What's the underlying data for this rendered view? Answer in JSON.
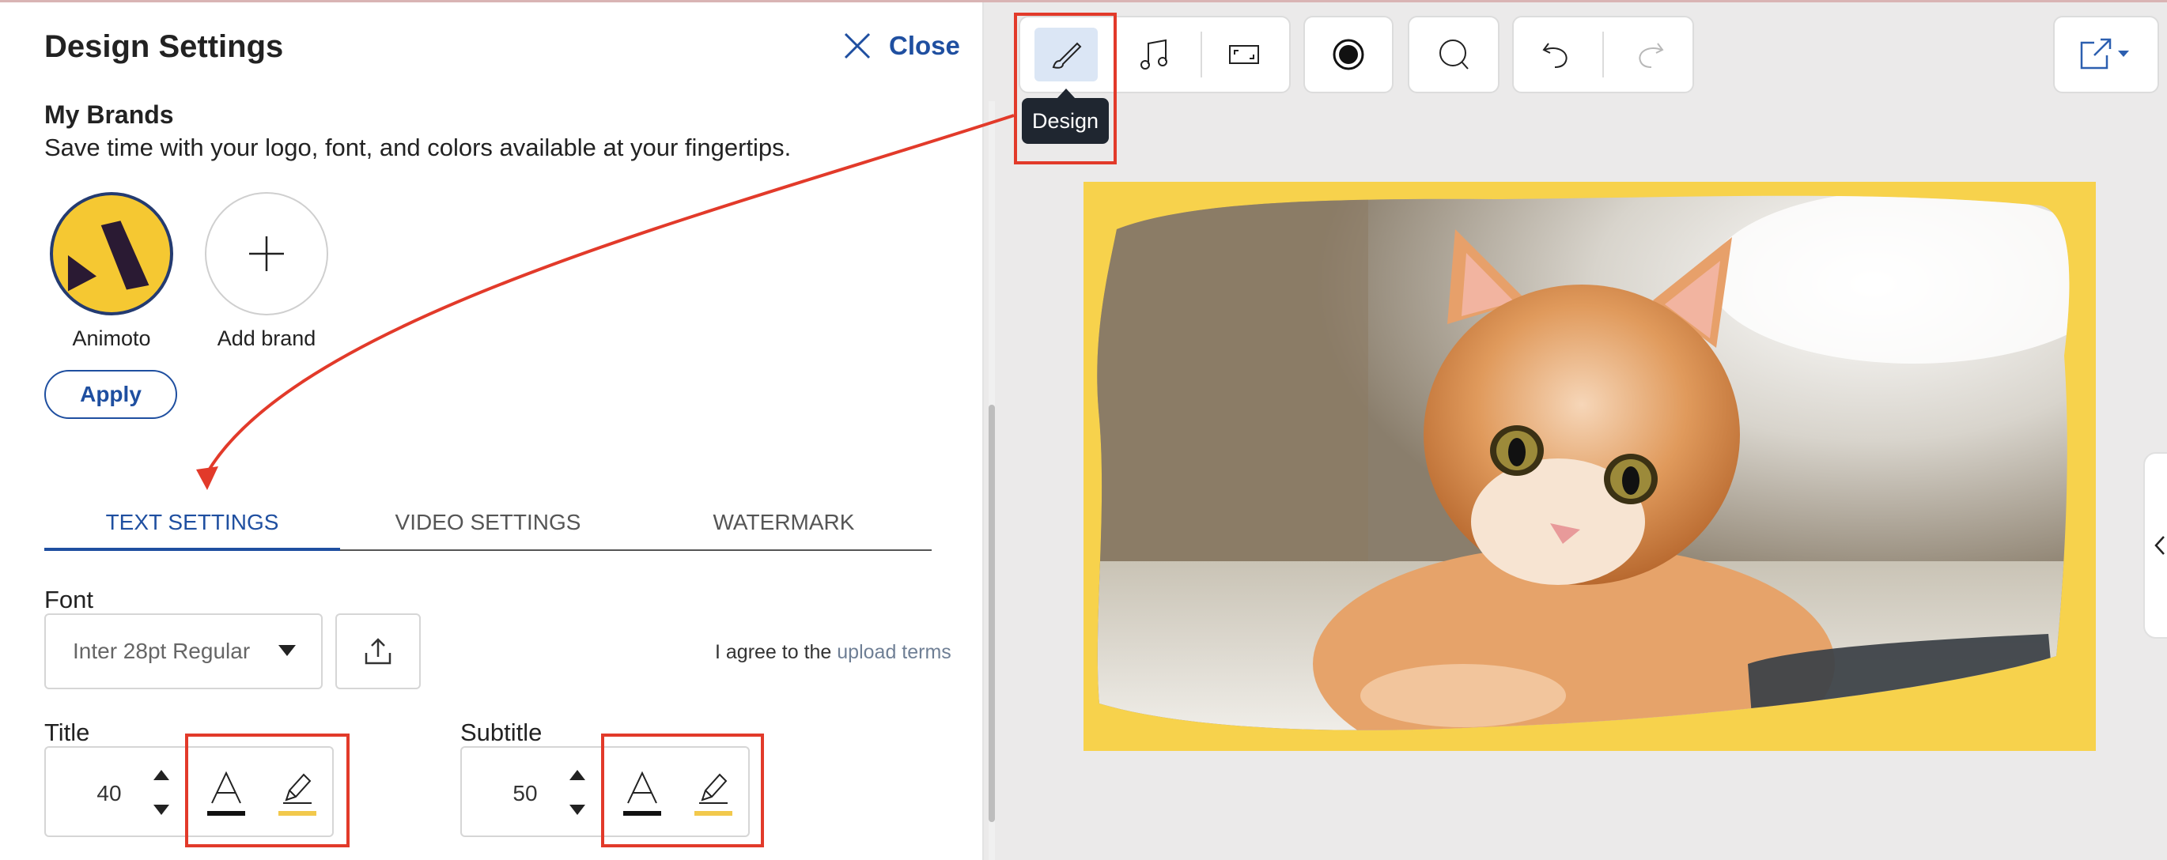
{
  "panel": {
    "title": "Design Settings",
    "close_label": "Close"
  },
  "brands": {
    "heading": "My Brands",
    "description": "Save time with your logo, font, and colors available at your fingertips.",
    "items": [
      {
        "label": "Animoto",
        "icon": "animoto-logo"
      },
      {
        "label": "Add brand",
        "icon": "plus-icon"
      }
    ],
    "apply_label": "Apply"
  },
  "tabs": [
    {
      "label": "TEXT SETTINGS",
      "active": true
    },
    {
      "label": "VIDEO SETTINGS",
      "active": false
    },
    {
      "label": "WATERMARK",
      "active": false
    }
  ],
  "font": {
    "label": "Font",
    "selected": "Inter 28pt Regular",
    "agree_prefix": "I agree to the",
    "agree_link": "upload terms"
  },
  "title_setting": {
    "label": "Title",
    "size": "40",
    "text_color": "#111111",
    "highlight_color": "#f2c94c"
  },
  "subtitle_setting": {
    "label": "Subtitle",
    "size": "50",
    "text_color": "#111111",
    "highlight_color": "#f2c94c"
  },
  "toolbar": {
    "tooltip": "Design",
    "icons": [
      "design-brush-icon",
      "music-note-icon",
      "aspect-ratio-icon",
      "record-icon",
      "comment-icon",
      "undo-icon",
      "redo-icon",
      "share-export-icon"
    ]
  },
  "colors": {
    "accent": "#1f4fa0",
    "annotation": "#e23a2a",
    "canvas_frame": "#f7d24c"
  }
}
